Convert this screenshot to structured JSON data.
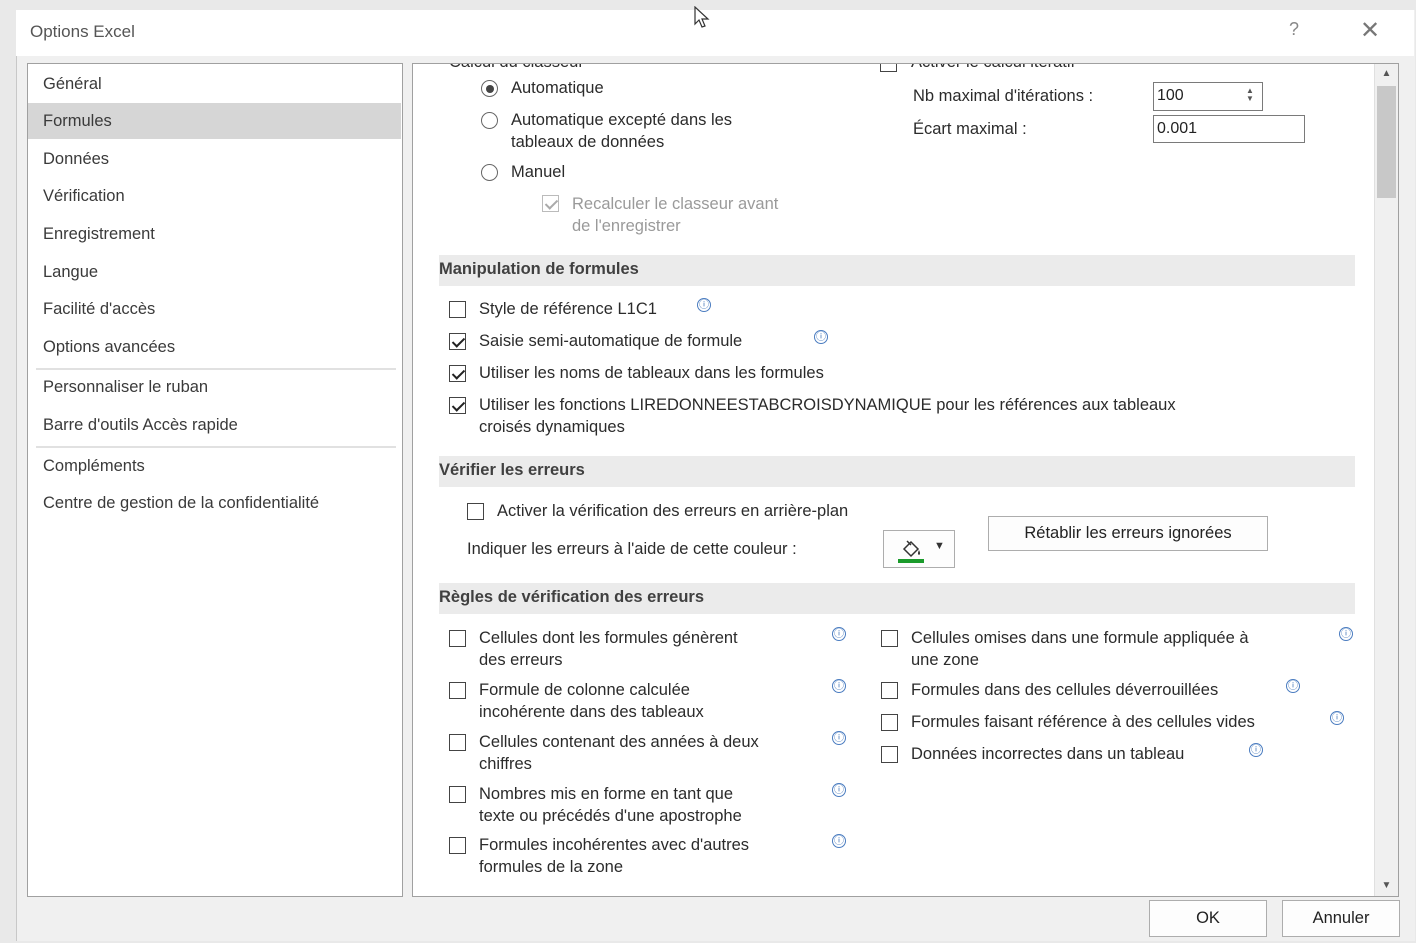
{
  "window": {
    "title": "Options Excel",
    "help": "?",
    "close": "✕"
  },
  "nav": {
    "items": [
      "Général",
      "Formules",
      "Données",
      "Vérification",
      "Enregistrement",
      "Langue",
      "Facilité d'accès",
      "Options avancées",
      "Personnaliser le ruban",
      "Barre d'outils Accès rapide",
      "Compléments",
      "Centre de gestion de la confidentialité"
    ],
    "selected": "Formules"
  },
  "calc": {
    "group_label_cut": "Calcul du classeur",
    "iter_label_cut": "Activer le calcul itératif",
    "radio_auto": "Automatique",
    "radio_auto_except_1": "Automatique excepté dans les",
    "radio_auto_except_2": "tableaux de données",
    "radio_manual": "Manuel",
    "recalc_1": "Recalculer le classeur avant",
    "recalc_2": "de l'enregistrer",
    "max_iter_label": "Nb maximal d'itérations :",
    "max_iter_value": "100",
    "max_change_label": "Écart maximal :",
    "max_change_value": "0.001"
  },
  "formulas": {
    "header": "Manipulation de formules",
    "r1c1": "Style de référence L1C1",
    "autocomplete": "Saisie semi-automatique de formule",
    "table_names": "Utiliser les noms de tableaux dans les formules",
    "getpivot_1": "Utiliser les fonctions LIREDONNEESTABCROISDYNAMIQUE pour les références aux tableaux",
    "getpivot_2": "croisés dynamiques"
  },
  "errors": {
    "header": "Vérifier les erreurs",
    "background": "Activer la vérification des erreurs en arrière-plan",
    "color_label": "Indiquer les erreurs à l'aide de cette couleur :",
    "reset_button": "Rétablir les erreurs ignorées",
    "color": "#1a9b2b"
  },
  "rules": {
    "header": "Règles de vérification des erreurs",
    "left": [
      [
        "Cellules dont les formules génèrent",
        "des erreurs"
      ],
      [
        "Formule de colonne calculée",
        "incohérente dans des tableaux"
      ],
      [
        "Cellules contenant des années à deux",
        "chiffres"
      ],
      [
        "Nombres mis en forme en tant que",
        "texte ou précédés d'une apostrophe"
      ],
      [
        "Formules incohérentes avec d'autres",
        "formules de la zone"
      ]
    ],
    "right": [
      [
        "Cellules omises dans une formule appliquée à",
        "une zone"
      ],
      [
        "Formules dans des cellules déverrouillées",
        ""
      ],
      [
        "Formules faisant référence à des cellules vides",
        ""
      ],
      [
        "Données incorrectes dans un tableau",
        ""
      ]
    ]
  },
  "footer": {
    "ok": "OK",
    "cancel": "Annuler"
  },
  "icons": {
    "info": "ⓘ",
    "scroll_up": "▲",
    "scroll_down": "▼",
    "dropdown": "▼"
  }
}
